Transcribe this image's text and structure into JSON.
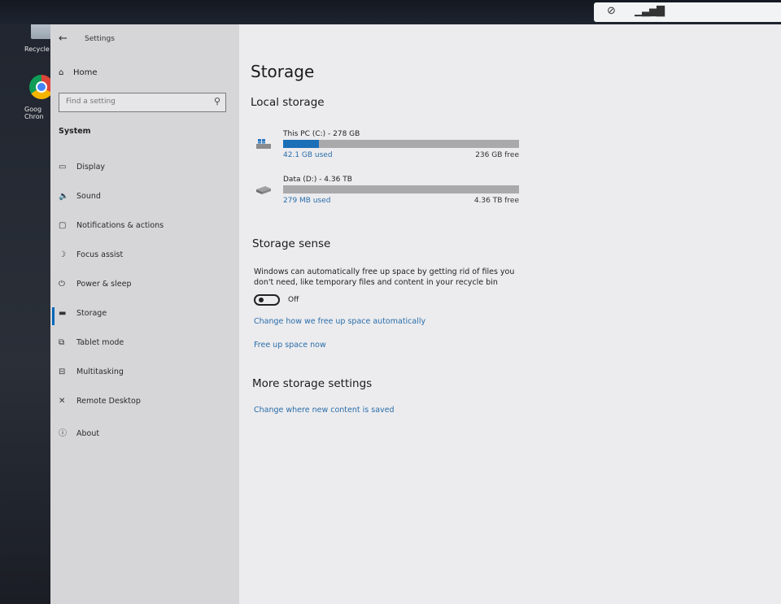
{
  "desktop": {
    "icons": [
      {
        "label": "Recycle",
        "icon": "recycle-bin-icon"
      },
      {
        "label": "Goog\nChron",
        "icon": "chrome-icon"
      }
    ]
  },
  "tray": {
    "icons": [
      "network-disconnected-icon",
      "signal-bars-icon"
    ]
  },
  "window": {
    "title": "Settings",
    "back_icon": "back-arrow-icon"
  },
  "nav": {
    "home_label": "Home",
    "search_placeholder": "Find a setting",
    "section_title": "System",
    "selected": "Storage",
    "items": [
      {
        "label": "Display",
        "icon": "display-icon"
      },
      {
        "label": "Sound",
        "icon": "sound-icon"
      },
      {
        "label": "Notifications & actions",
        "icon": "notifications-icon"
      },
      {
        "label": "Focus assist",
        "icon": "focus-assist-icon"
      },
      {
        "label": "Power & sleep",
        "icon": "power-icon"
      },
      {
        "label": "Storage",
        "icon": "storage-icon"
      },
      {
        "label": "Tablet mode",
        "icon": "tablet-mode-icon"
      },
      {
        "label": "Multitasking",
        "icon": "multitasking-icon"
      },
      {
        "label": "Remote Desktop",
        "icon": "remote-desktop-icon"
      },
      {
        "label": "About",
        "icon": "info-icon"
      }
    ]
  },
  "main": {
    "title": "Storage",
    "local_storage_heading": "Local storage",
    "drives": [
      {
        "name": "This PC (C:) - 278 GB",
        "used": "42.1 GB used",
        "free": "236 GB free",
        "used_fraction": 0.15,
        "icon": "windows-drive-icon"
      },
      {
        "name": "Data (D:) - 4.36 TB",
        "used": "279 MB used",
        "free": "4.36 TB free",
        "used_fraction": 0.0,
        "icon": "drive-icon"
      }
    ],
    "storage_sense": {
      "heading": "Storage sense",
      "description": "Windows can automatically free up space by getting rid of files you don't need, like temporary files and content in your recycle bin",
      "toggle_state": "Off",
      "link_change": "Change how we free up space automatically",
      "link_free": "Free up space now"
    },
    "more": {
      "heading": "More storage settings",
      "link_new_content": "Change where new content is saved"
    }
  },
  "colors": {
    "accent": "#1a6fb7",
    "link": "#2a6da8",
    "nav_bg": "#d6d6d9",
    "content_bg": "#ececef"
  }
}
